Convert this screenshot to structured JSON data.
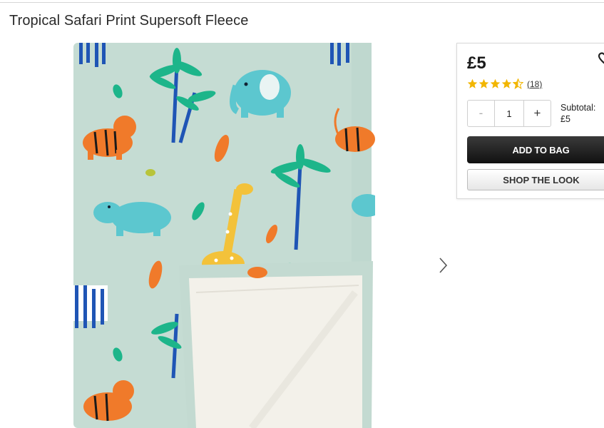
{
  "product": {
    "title": "Tropical Safari Print Supersoft Fleece",
    "price": "£5",
    "rating_value": 4.5,
    "rating_max": 5,
    "review_count": "(18)"
  },
  "quantity": {
    "minus_label": "-",
    "value": "1",
    "plus_label": "+"
  },
  "subtotal": {
    "label": "Subtotal:",
    "value": "£5"
  },
  "buttons": {
    "add_to_bag": "ADD TO BAG",
    "shop_the_look": "SHOP THE LOOK"
  },
  "icons": {
    "next": "chevron-right-icon",
    "wishlist": "heart-icon",
    "star": "star-icon"
  },
  "colors": {
    "blanket_mint": "#c6ddd4",
    "star_gold": "#f2b600",
    "button_dark": "#1e1e1e"
  }
}
